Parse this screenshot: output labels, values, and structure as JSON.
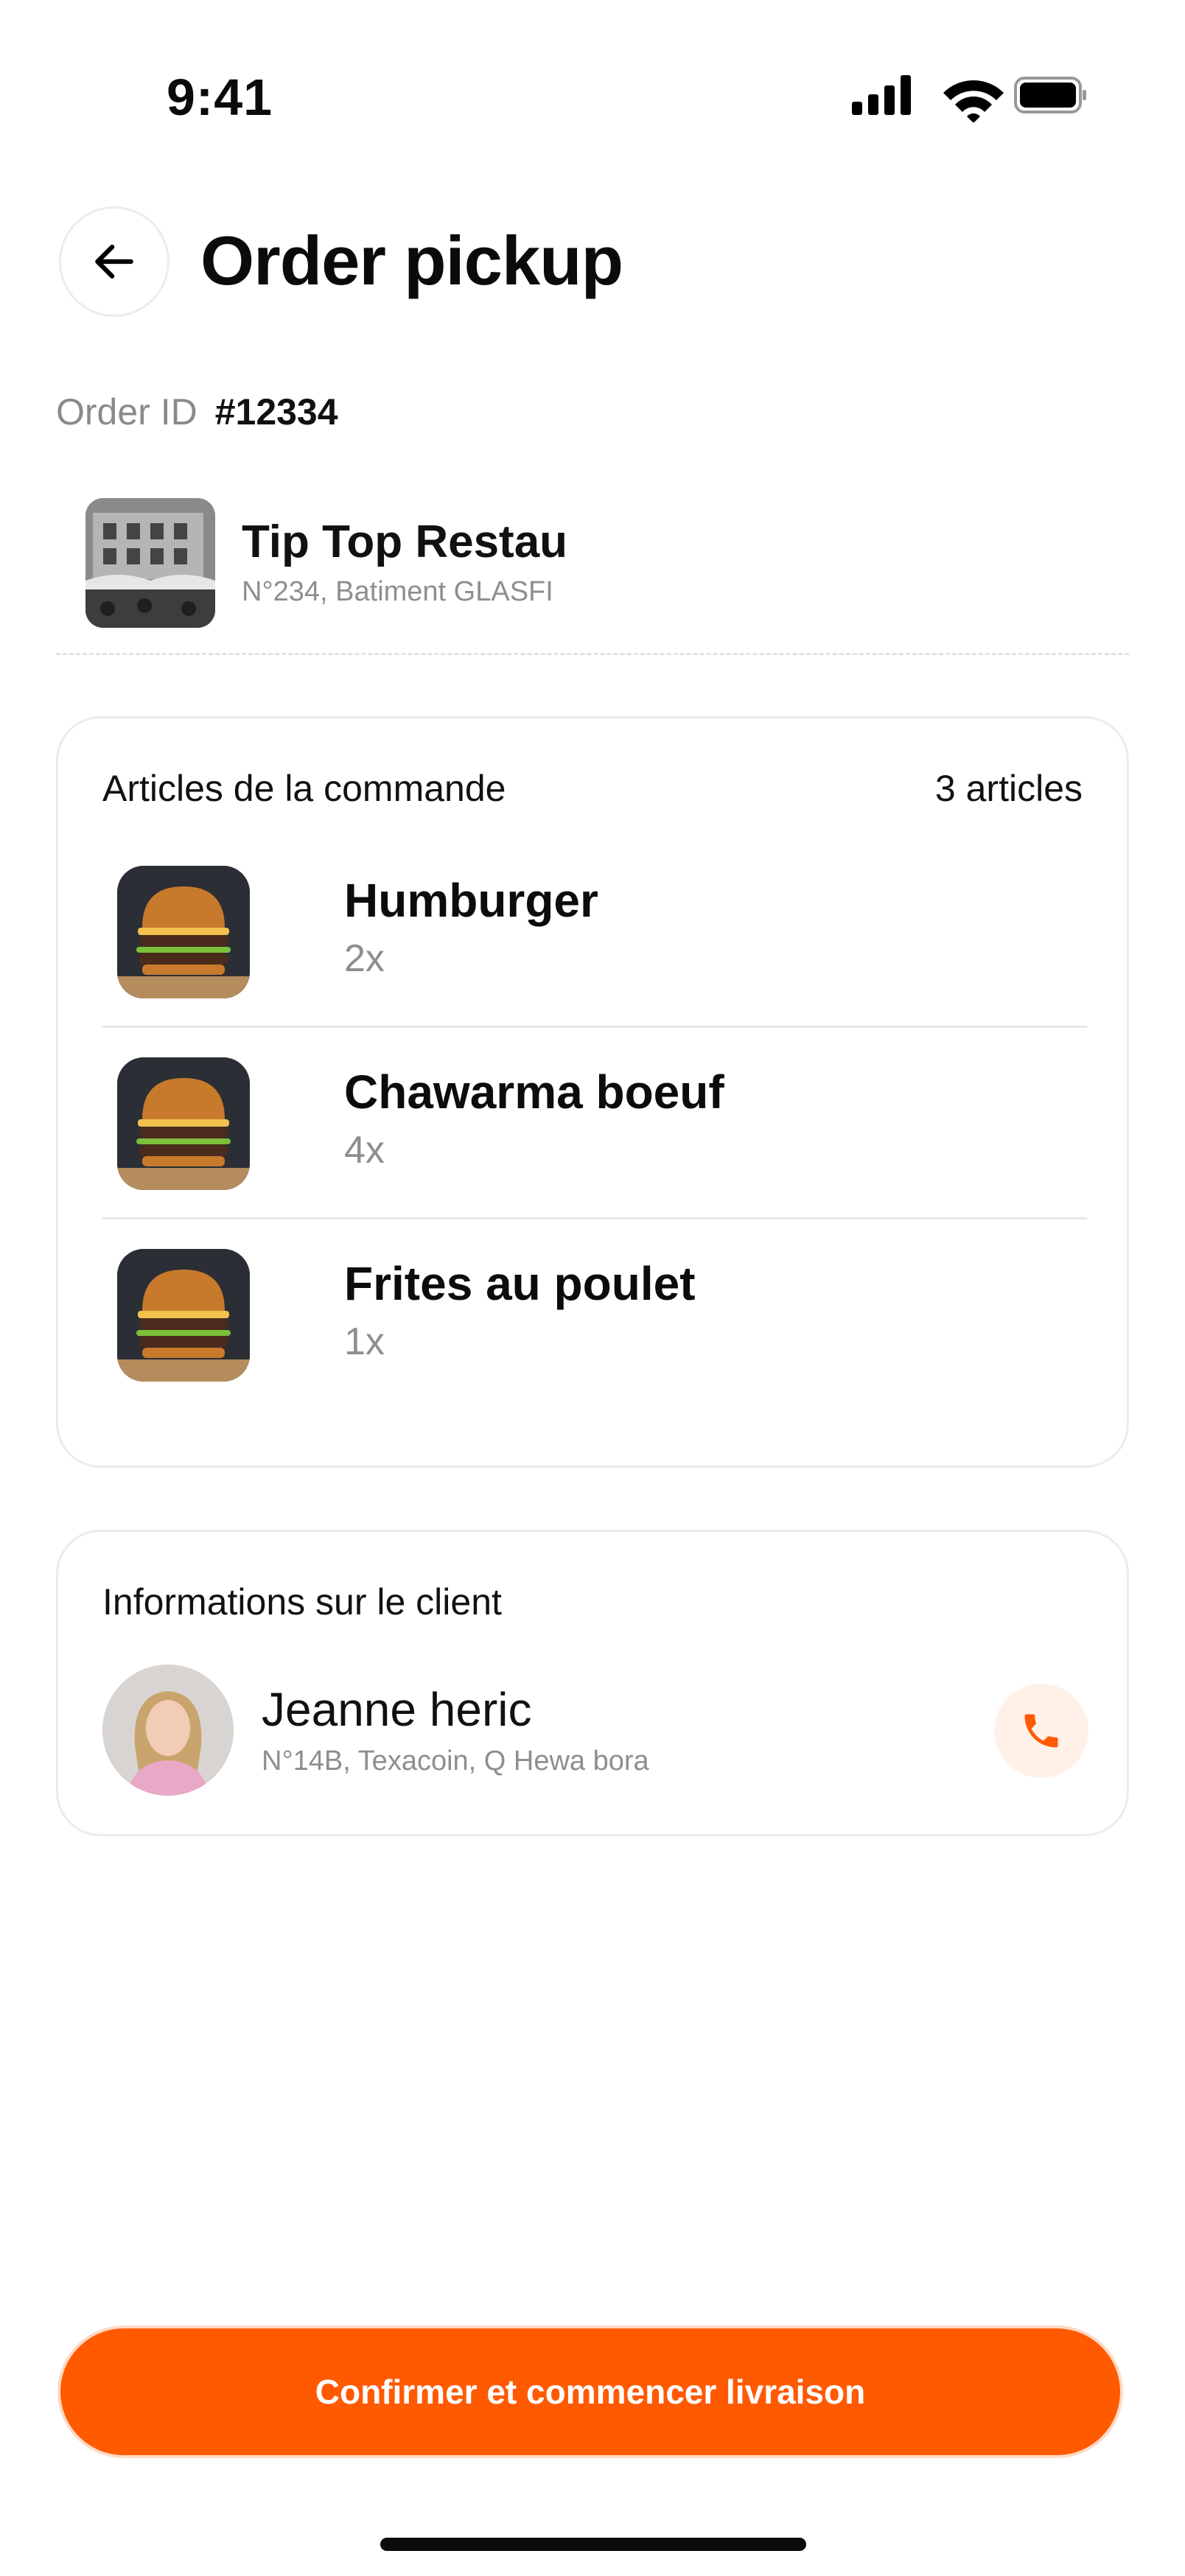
{
  "status_bar": {
    "time": "9:41",
    "icons": [
      "cellular-signal-icon",
      "wifi-icon",
      "battery-icon"
    ]
  },
  "header": {
    "back_icon": "arrow-left-icon",
    "title": "Order pickup"
  },
  "order": {
    "id_label": "Order ID",
    "id_value": "#12334"
  },
  "restaurant": {
    "name": "Tip Top Restau",
    "address": "N°234, Batiment GLASFI"
  },
  "articles": {
    "title": "Articles de la commande",
    "count": "3 articles",
    "items": [
      {
        "name": "Humburger",
        "qty": "2x"
      },
      {
        "name": "Chawarma boeuf",
        "qty": "4x"
      },
      {
        "name": "Frites au poulet",
        "qty": "1x"
      }
    ]
  },
  "client": {
    "title": "Informations sur le client",
    "name": "Jeanne heric",
    "address": "N°14B, Texacoin, Q Hewa bora",
    "call_icon": "phone-icon"
  },
  "actions": {
    "confirm_label": "Confirmer et commencer livraison"
  },
  "colors": {
    "accent": "#FF5A00",
    "accent_soft": "#FFF1E8",
    "muted_text": "#8E8E8E",
    "border": "#ECECEC"
  }
}
